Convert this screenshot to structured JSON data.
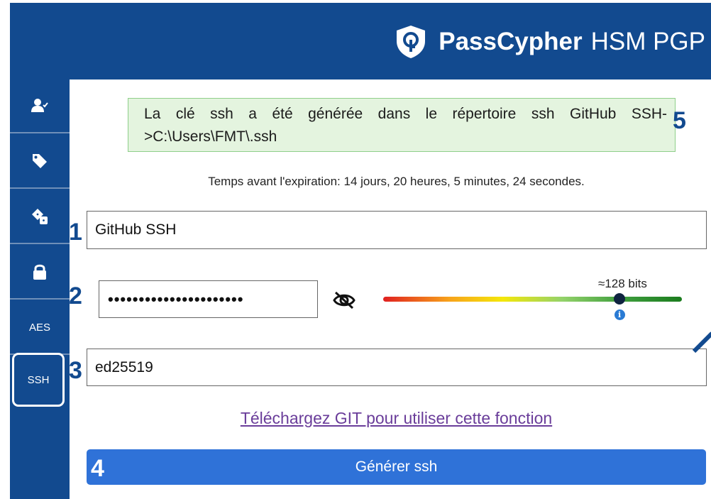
{
  "header": {
    "brand_name": "PassCypher",
    "brand_suffix": "HSM PGP",
    "logo_icon": "shield-key-icon"
  },
  "sidebar": {
    "items": [
      {
        "icon": "user-check-icon"
      },
      {
        "icon": "tag-icon"
      },
      {
        "icon": "dice-icon"
      },
      {
        "icon": "lock-icon"
      },
      {
        "label": "AES"
      },
      {
        "label": "SSH",
        "active": true
      }
    ]
  },
  "notice": {
    "text": "La clé ssh a été générée dans le répertoire ssh GitHub SSH->C:\\Users\\FMT\\.ssh"
  },
  "expiry": {
    "text": "Temps avant l'expiration: 14 jours, 20 heures, 5 minutes, 24 secondes."
  },
  "steps": [
    "1",
    "2",
    "3",
    "4",
    "5"
  ],
  "form": {
    "name_value": "GitHub SSH",
    "password_value": "••••••••••••••••••••••",
    "strength_label": "≈128 bits",
    "strength_fraction": 0.79,
    "key_type_value": "ed25519",
    "info_glyph": "i"
  },
  "download_link": "Téléchargez GIT pour utiliser cette fonction",
  "generate_button": "Générer ssh",
  "colors": {
    "primary": "#124a8f",
    "button": "#2f72d8",
    "notice_bg": "#e4f4df",
    "link": "#6a3d9a"
  }
}
